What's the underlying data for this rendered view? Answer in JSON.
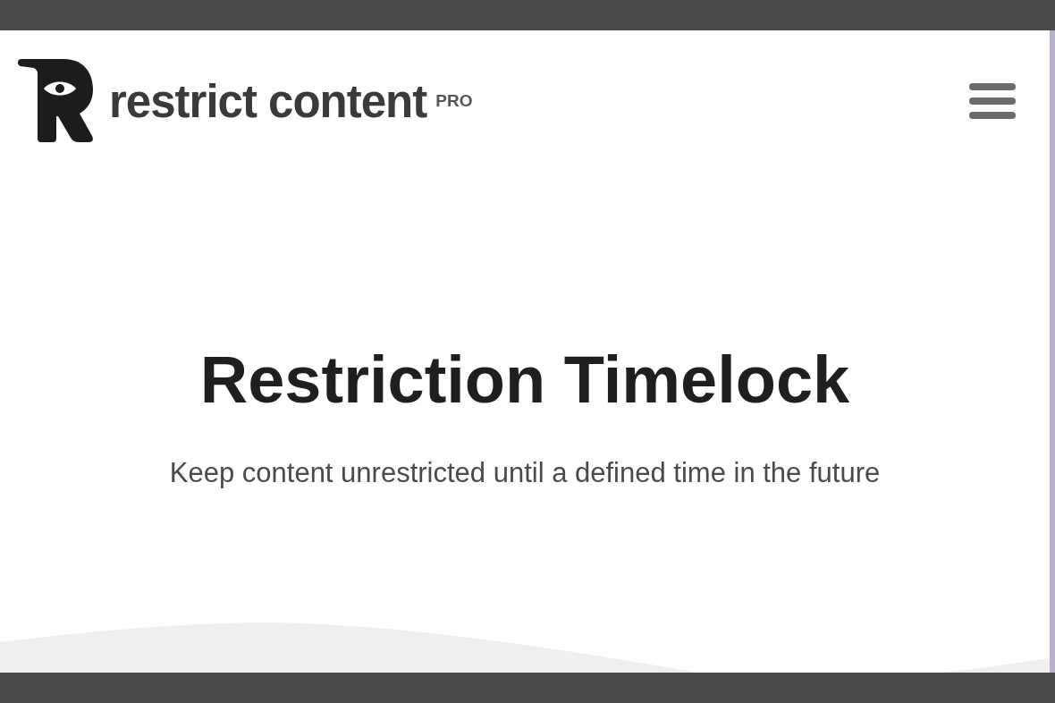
{
  "header": {
    "logo": {
      "wordmark": "restrict content",
      "badge": "PRO"
    }
  },
  "hero": {
    "title": "Restriction Timelock",
    "subtitle": "Keep content unrestricted until a defined time in the future"
  }
}
